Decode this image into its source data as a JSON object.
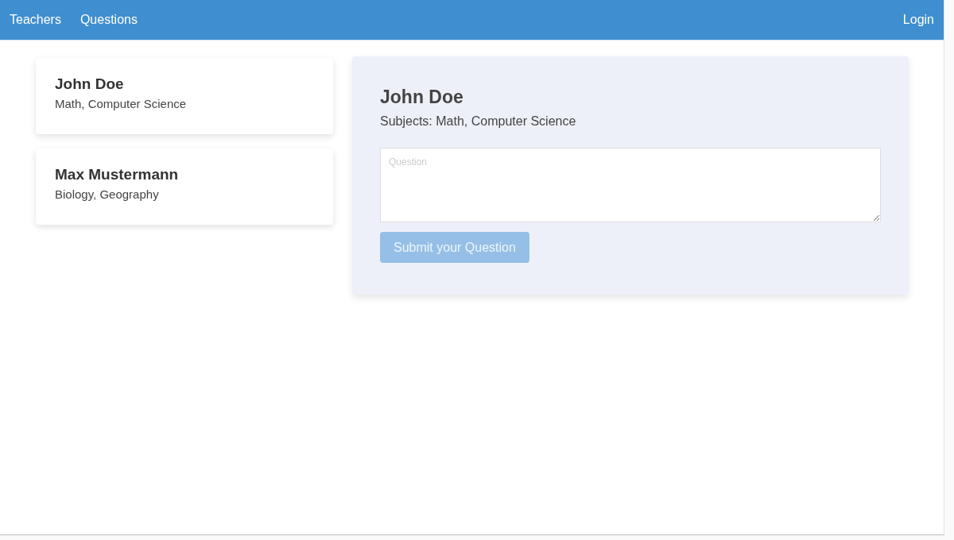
{
  "nav": {
    "links": [
      "Teachers",
      "Questions"
    ],
    "login": "Login"
  },
  "teachers": [
    {
      "name": "John Doe",
      "subjects": "Math, Computer Science"
    },
    {
      "name": "Max Mustermann",
      "subjects": "Biology, Geography"
    }
  ],
  "detail": {
    "name": "John Doe",
    "subjects": "Subjects: Math, Computer Science",
    "question": {
      "placeholder": "Question"
    },
    "submit": {
      "label": "Submit your Question",
      "disabled": true
    }
  }
}
